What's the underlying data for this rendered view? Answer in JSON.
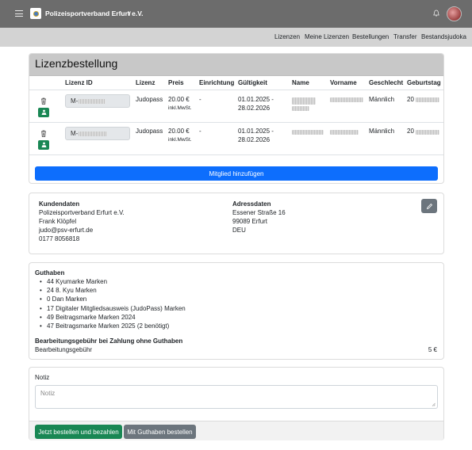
{
  "topbar": {
    "org_name": "Polizeisportverband Erfurt e.V.",
    "chevron": "∨",
    "menu_icon": "hamburger-icon",
    "logo_icon": "club-logo",
    "bell_icon": "bell-icon",
    "avatar": "user-avatar"
  },
  "subnav": {
    "items": [
      "Lizenzen",
      "Meine Lizenzen",
      "Bestellungen",
      "Transfer",
      "Bestandsjudoka"
    ]
  },
  "order": {
    "title": "Lizenzbestellung",
    "columns": [
      "Lizenz ID",
      "Lizenz",
      "Preis",
      "Einrichtung",
      "Gültigkeit",
      "Name",
      "Vorname",
      "Geschlecht",
      "Geburtstag"
    ],
    "rows": [
      {
        "license_id_prefix": "M-",
        "license": "Judopass",
        "price": "20.00 €",
        "price_note": "inkl.MwSt.",
        "facility": "-",
        "valid_from": "01.01.2025 -",
        "valid_to": "28.02.2026",
        "gender": "Männlich",
        "birth_prefix": "20"
      },
      {
        "license_id_prefix": "M-",
        "license": "Judopass",
        "price": "20.00 €",
        "price_note": "inkl.MwSt.",
        "facility": "-",
        "valid_from": "01.01.2025 -",
        "valid_to": "28.02.2026",
        "gender": "Männlich",
        "birth_prefix": "20"
      }
    ],
    "add_member_label": "Mitglied hinzufügen",
    "accent_blue": "#0d6efd",
    "accent_green": "#198754"
  },
  "customer": {
    "heading": "Kundendaten",
    "lines": [
      "Polizeisportverband Erfurt e.V.",
      "Frank Klöpfel",
      "judo@psv-erfurt.de",
      "0177 8056818"
    ]
  },
  "address": {
    "heading": "Adressdaten",
    "lines": [
      "Essener Straße 16",
      "99089 Erfurt",
      "DEU"
    ]
  },
  "credit": {
    "heading": "Guthaben",
    "items": [
      "44 Kyumarke Marken",
      "24 8. Kyu Marken",
      "0 Dan Marken",
      "17 Digitaler Mitgliedsausweis (JudoPass) Marken",
      "49 Beitragsmarke Marken 2024",
      "47 Beitragsmarke Marken 2025 (2 benötigt)"
    ],
    "fee_heading": "Bearbeitungsgebühr bei Zahlung ohne Guthaben",
    "fee_label": "Bearbeitungsgebühr",
    "fee_value": "5 €"
  },
  "note": {
    "label": "Notiz",
    "placeholder": "Notiz"
  },
  "actions": {
    "order_pay": "Jetzt bestellen und bezahlen",
    "order_credit": "Mit Guthaben bestellen",
    "green": "#198754",
    "gray": "#6c757d"
  }
}
